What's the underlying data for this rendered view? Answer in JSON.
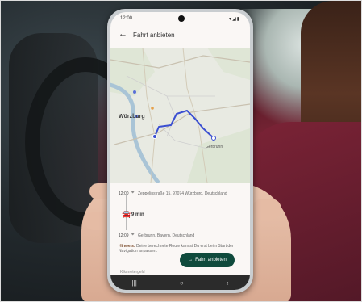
{
  "status": {
    "time": "12:00",
    "icons": "▾◢▮"
  },
  "appbar": {
    "back_icon": "arrow-left-icon",
    "title": "Fahrt anbieten"
  },
  "map": {
    "city_label": "Würzburg",
    "town_label": "Gerbrunn"
  },
  "route": {
    "start_time": "12:00",
    "start_address": "Zeppelinstraße 15, 97074 Würzburg, Deutschland",
    "duration": "9 min",
    "end_time": "12:09",
    "end_address": "Gerbrunn, Bayern, Deutschland"
  },
  "hint": {
    "label": "Hinweis:",
    "text": "Deine berechnete Route kannst Du erst beim Start der Navigation anpassen."
  },
  "footer": {
    "link": "Kilometergeld"
  },
  "cta": {
    "label": "Fahrt anbieten",
    "icon": "arrow-right-icon",
    "color": "#0f4a3c"
  },
  "navbar": {
    "recent": "|||",
    "home": "○",
    "back": "‹"
  }
}
